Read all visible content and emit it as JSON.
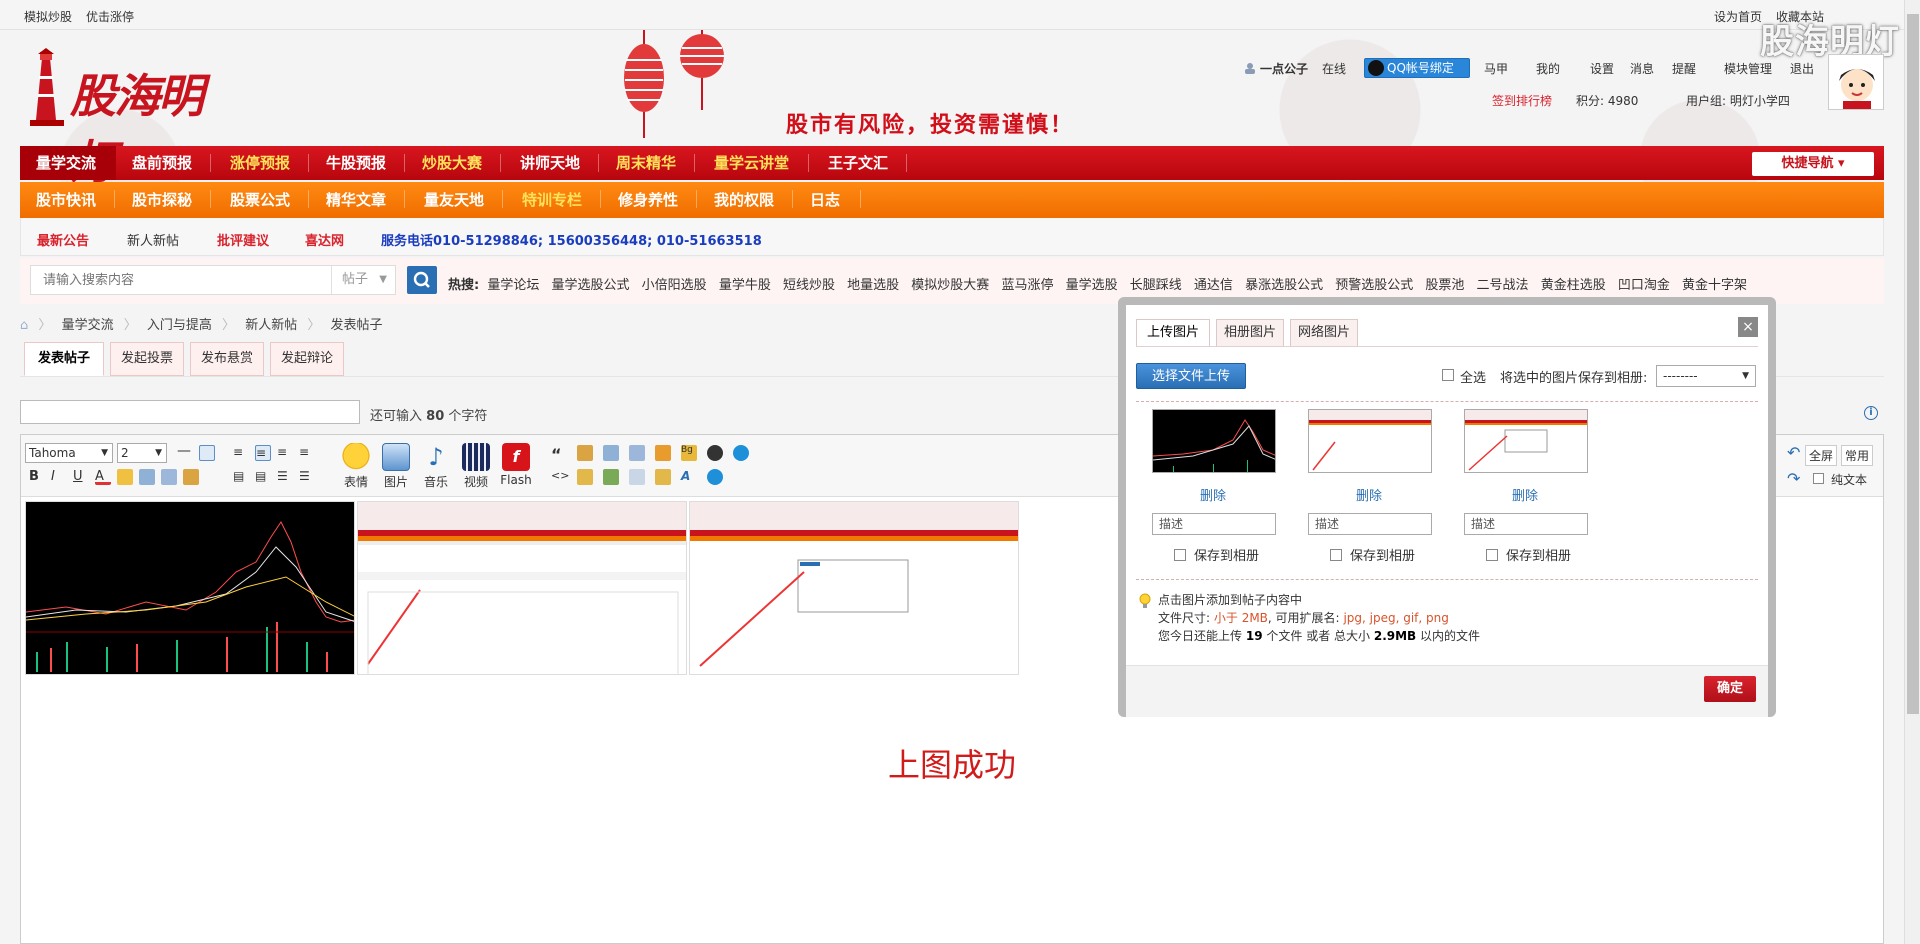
{
  "topbar": {
    "left_links": [
      "模拟炒股",
      "优击涨停"
    ],
    "right_links": [
      "设为首页",
      "收藏本站"
    ]
  },
  "watermark": "股海明灯",
  "header": {
    "logo_text": "股海明灯",
    "slogan": "股市有风险，投资需谨慎！"
  },
  "user": {
    "name": "一点公子",
    "status": "在线",
    "qq_bind": "QQ帐号绑定",
    "menu": [
      "马甲",
      "我的",
      "设置",
      "消息",
      "提醒",
      "模块管理",
      "退出"
    ],
    "sign_rank": "签到排行榜",
    "points": "积分: 4980",
    "group": "用户组: 明灯小学四"
  },
  "nav1": {
    "items": [
      "量学交流",
      "盘前预报",
      "涨停预报",
      "牛股预报",
      "炒股大赛",
      "讲师天地",
      "周末精华",
      "量学云讲堂",
      "王子文汇"
    ],
    "quick_nav": "快捷导航"
  },
  "nav2": {
    "items": [
      "股市快讯",
      "股市探秘",
      "股票公式",
      "精华文章",
      "量友天地",
      "特训专栏",
      "修身养性",
      "我的权限",
      "日志"
    ]
  },
  "nav3": {
    "items": [
      "最新公告",
      "新人新帖",
      "批评建议",
      "喜达网"
    ],
    "phone": "服务电话010-51298846; 15600356448; 010-51663518"
  },
  "search": {
    "placeholder": "请输入搜索内容",
    "type": "帖子",
    "hot_label": "热搜:",
    "hot_words": [
      "量学论坛",
      "量学选股公式",
      "小倍阳选股",
      "量学牛股",
      "短线炒股",
      "地量选股",
      "模拟炒股大赛",
      "蓝马涨停",
      "量学选股",
      "长腿踩线",
      "通达信",
      "暴涨选股公式",
      "预警选股公式",
      "股票池",
      "二号战法",
      "黄金柱选股",
      "凹口淘金",
      "黄金十字架"
    ]
  },
  "breadcrumb": [
    "量学交流",
    "入门与提高",
    "新人新帖",
    "发表帖子"
  ],
  "post_tabs": [
    "发表帖子",
    "发起投票",
    "发布悬赏",
    "发起辩论"
  ],
  "title_field": {
    "remaining_prefix": "还可输入",
    "remaining_count": "80",
    "remaining_suffix": "个字符"
  },
  "toolbar": {
    "font_family": "Tahoma",
    "font_size": "2",
    "big_buttons": [
      "表情",
      "图片",
      "音乐",
      "视频",
      "Flash"
    ],
    "fullscreen": "全屏",
    "common": "常用",
    "plain_text": "纯文本"
  },
  "content": {
    "success_text": "上图成功"
  },
  "upload_dialog": {
    "tabs": [
      "上传图片",
      "相册图片",
      "网络图片"
    ],
    "close": "×",
    "select_file": "选择文件上传",
    "select_all": "全选",
    "save_selected_label": "将选中的图片保存到相册:",
    "album_value": "--------",
    "images": [
      {
        "delete": "删除",
        "desc_placeholder": "描述",
        "save_label": "保存到相册"
      },
      {
        "delete": "删除",
        "desc_placeholder": "描述",
        "save_label": "保存到相册"
      },
      {
        "delete": "删除",
        "desc_placeholder": "描述",
        "save_label": "保存到相册"
      }
    ],
    "info": {
      "line1": "点击图片添加到帖子内容中",
      "size_prefix": "文件尺寸:",
      "size_limit": "小于 2MB",
      "ext_prefix": ", 可用扩展名:",
      "extensions": "jpg, jpeg, gif, png",
      "quota_prefix": "您今日还能上传",
      "quota_files": "19",
      "quota_mid": "个文件 或者 总大小",
      "quota_size": "2.9MB",
      "quota_suffix": "以内的文件"
    },
    "confirm": "确定"
  },
  "colors": {
    "brand_red": "#c8141e",
    "nav_orange": "#f07a00",
    "link_blue": "#2a6fb4"
  }
}
